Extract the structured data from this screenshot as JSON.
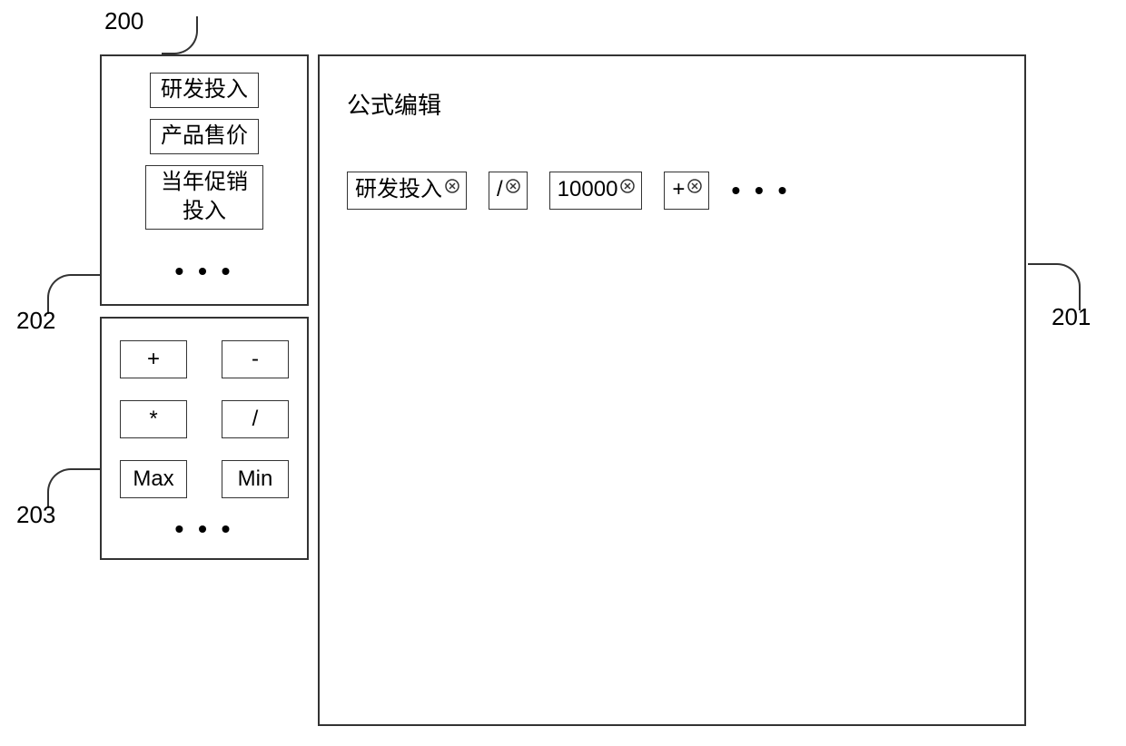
{
  "refs": {
    "fig": "200",
    "editor": "201",
    "vars": "202",
    "ops": "203"
  },
  "sidebar": {
    "variables": {
      "items": [
        {
          "label": "研发投入"
        },
        {
          "label": "产品售价"
        },
        {
          "label": "当年促销投入"
        }
      ],
      "more": "• • •"
    },
    "operators": {
      "items": [
        {
          "label": "+"
        },
        {
          "label": "-"
        },
        {
          "label": "*"
        },
        {
          "label": "/"
        },
        {
          "label": "Max"
        },
        {
          "label": "Min"
        }
      ],
      "more": "• • •"
    }
  },
  "editor": {
    "title": "公式编辑",
    "tokens": [
      {
        "text": "研发投入"
      },
      {
        "text": "/"
      },
      {
        "text": "10000"
      },
      {
        "text": "+"
      }
    ],
    "more": "• • •"
  }
}
